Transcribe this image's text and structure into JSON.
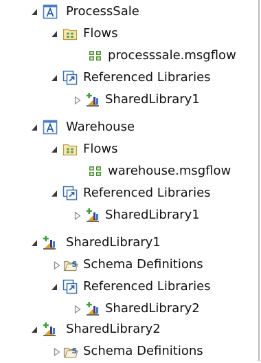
{
  "tree": [
    {
      "label": "ProcessSale",
      "icon": "application-icon",
      "state": "expanded",
      "depth": 0
    },
    {
      "label": "Flows",
      "icon": "flows-folder-icon",
      "state": "expanded",
      "depth": 1
    },
    {
      "label": "processsale.msgflow",
      "icon": "msgflow-file-icon",
      "state": "leaf",
      "depth": 2
    },
    {
      "label": "Referenced Libraries",
      "icon": "referenced-libraries-icon",
      "state": "expanded",
      "depth": 1
    },
    {
      "label": "SharedLibrary1",
      "icon": "shared-library-icon",
      "state": "collapsed",
      "depth": 2
    },
    {
      "label": "Warehouse",
      "icon": "application-icon",
      "state": "expanded",
      "depth": 0
    },
    {
      "label": "Flows",
      "icon": "flows-folder-icon",
      "state": "expanded",
      "depth": 1
    },
    {
      "label": "warehouse.msgflow",
      "icon": "msgflow-file-icon",
      "state": "leaf",
      "depth": 2
    },
    {
      "label": "Referenced Libraries",
      "icon": "referenced-libraries-icon",
      "state": "expanded",
      "depth": 1
    },
    {
      "label": "SharedLibrary1",
      "icon": "shared-library-icon",
      "state": "collapsed",
      "depth": 2
    },
    {
      "label": "SharedLibrary1",
      "icon": "shared-library-icon",
      "state": "expanded",
      "depth": 0
    },
    {
      "label": "Schema Definitions",
      "icon": "schema-definitions-icon",
      "state": "collapsed",
      "depth": 1
    },
    {
      "label": "Referenced Libraries",
      "icon": "referenced-libraries-icon",
      "state": "expanded",
      "depth": 1
    },
    {
      "label": "SharedLibrary2",
      "icon": "shared-library-icon",
      "state": "collapsed",
      "depth": 2
    },
    {
      "label": "SharedLibrary2",
      "icon": "shared-library-icon",
      "state": "expanded",
      "depth": 0
    },
    {
      "label": "Schema Definitions",
      "icon": "schema-definitions-icon",
      "state": "collapsed",
      "depth": 1
    }
  ]
}
